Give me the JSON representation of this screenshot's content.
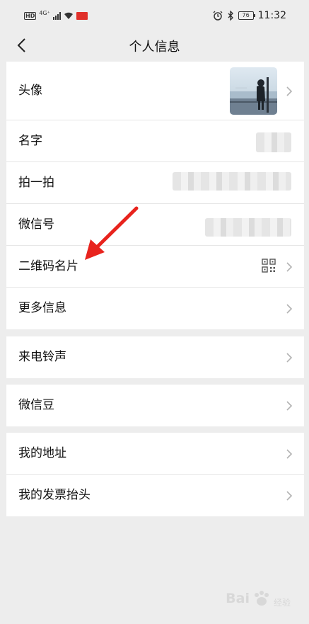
{
  "status_bar": {
    "hd_badge": "HD",
    "network": "4G⁺",
    "battery": "76",
    "time": "11:32"
  },
  "header": {
    "title": "个人信息"
  },
  "profile_group": {
    "avatar_label": "头像",
    "name_label": "名字",
    "pat_label": "拍一拍",
    "wechat_id_label": "微信号",
    "qr_code_label": "二维码名片",
    "more_info_label": "更多信息"
  },
  "ringtone_group": {
    "ringtone_label": "来电铃声"
  },
  "beans_group": {
    "beans_label": "微信豆"
  },
  "address_group": {
    "address_label": "我的地址",
    "invoice_label": "我的发票抬头"
  },
  "watermark": {
    "brand": "Bai",
    "suffix": "经验"
  },
  "colors": {
    "page_bg": "#ededed",
    "card_bg": "#ffffff",
    "annotation_arrow": "#e8231d"
  },
  "icons": {
    "back": "chevron-left-icon",
    "row_arrow": "chevron-right-icon",
    "qr": "qr-code-icon"
  }
}
